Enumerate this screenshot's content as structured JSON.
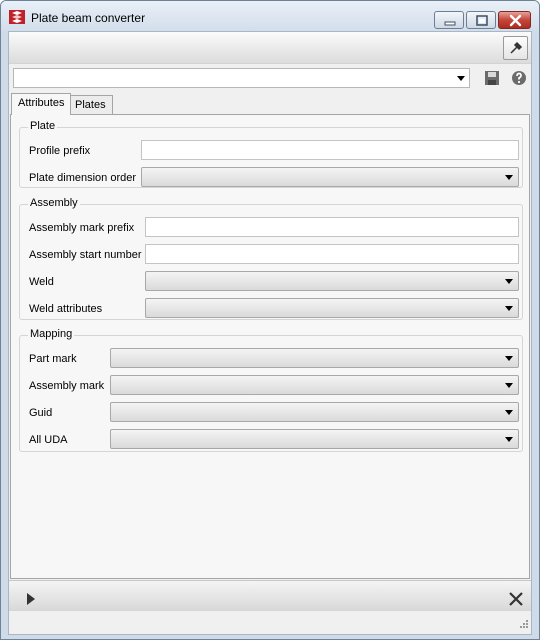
{
  "window": {
    "title": "Plate beam converter"
  },
  "toolbar": {
    "pin_icon": "pin-icon",
    "preset_value": "",
    "save_icon": "save-icon",
    "help_icon": "help-icon"
  },
  "tabs": [
    {
      "label": "Attributes",
      "active": true
    },
    {
      "label": "Plates",
      "active": false
    }
  ],
  "plate_group": {
    "title": "Plate",
    "profile_prefix_label": "Profile prefix",
    "profile_prefix_value": "",
    "dimension_order_label": "Plate dimension order",
    "dimension_order_value": ""
  },
  "assembly_group": {
    "title": "Assembly",
    "mark_prefix_label": "Assembly mark prefix",
    "mark_prefix_value": "",
    "start_number_label": "Assembly start number",
    "start_number_value": "",
    "weld_label": "Weld",
    "weld_value": "",
    "weld_attributes_label": "Weld attributes",
    "weld_attributes_value": ""
  },
  "mapping_group": {
    "title": "Mapping",
    "part_mark_label": "Part mark",
    "assembly_mark_label": "Assembly mark",
    "guid_label": "Guid",
    "all_uda_label": "All UDA"
  },
  "footer": {
    "run_icon": "play-icon",
    "close_icon": "close-icon"
  },
  "colors": {
    "title_bar": "#d2deeb",
    "close_button": "#c4463a",
    "panel": "#f0f0f0"
  }
}
